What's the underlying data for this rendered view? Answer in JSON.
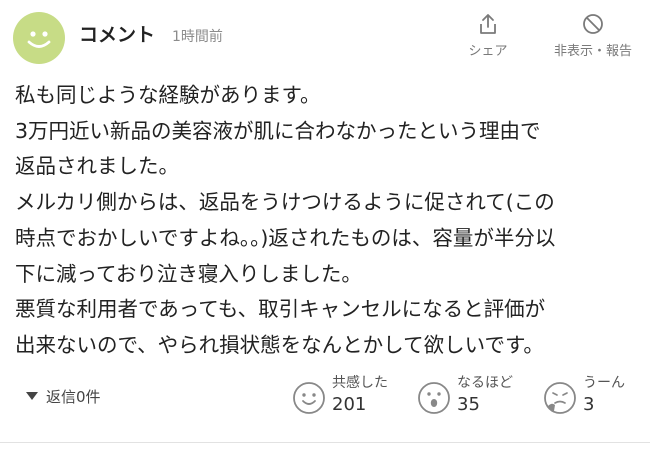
{
  "comment": {
    "author": "コメント",
    "time": "1時間前",
    "share_label": "シェア",
    "report_label": "非表示・報告",
    "avatar_icon": "smiley-face-icon",
    "avatar_color": "#c7dc86",
    "body_lines": [
      "私も同じような経験があります。",
      "3万円近い新品の美容液が肌に合わなかったという理由で",
      "返品されました。",
      "メルカリ側からは、返品をうけつけるように促されて(この",
      "時点でおかしいですよね。。)返されたものは、容量が半分以",
      "下に減っており泣き寝入りしました。",
      "悪質な利用者であっても、取引キャンセルになると評価が",
      "出来ないので、やられ損状態をなんとかして欲しいです。"
    ],
    "replies_label": "返信",
    "replies_count": "0件",
    "reactions": [
      {
        "label": "共感した",
        "count": "201",
        "icon": "smile-face-icon"
      },
      {
        "label": "なるほど",
        "count": "35",
        "icon": "surprised-face-icon"
      },
      {
        "label": "うーん",
        "count": "3",
        "icon": "pondering-face-icon"
      }
    ]
  }
}
